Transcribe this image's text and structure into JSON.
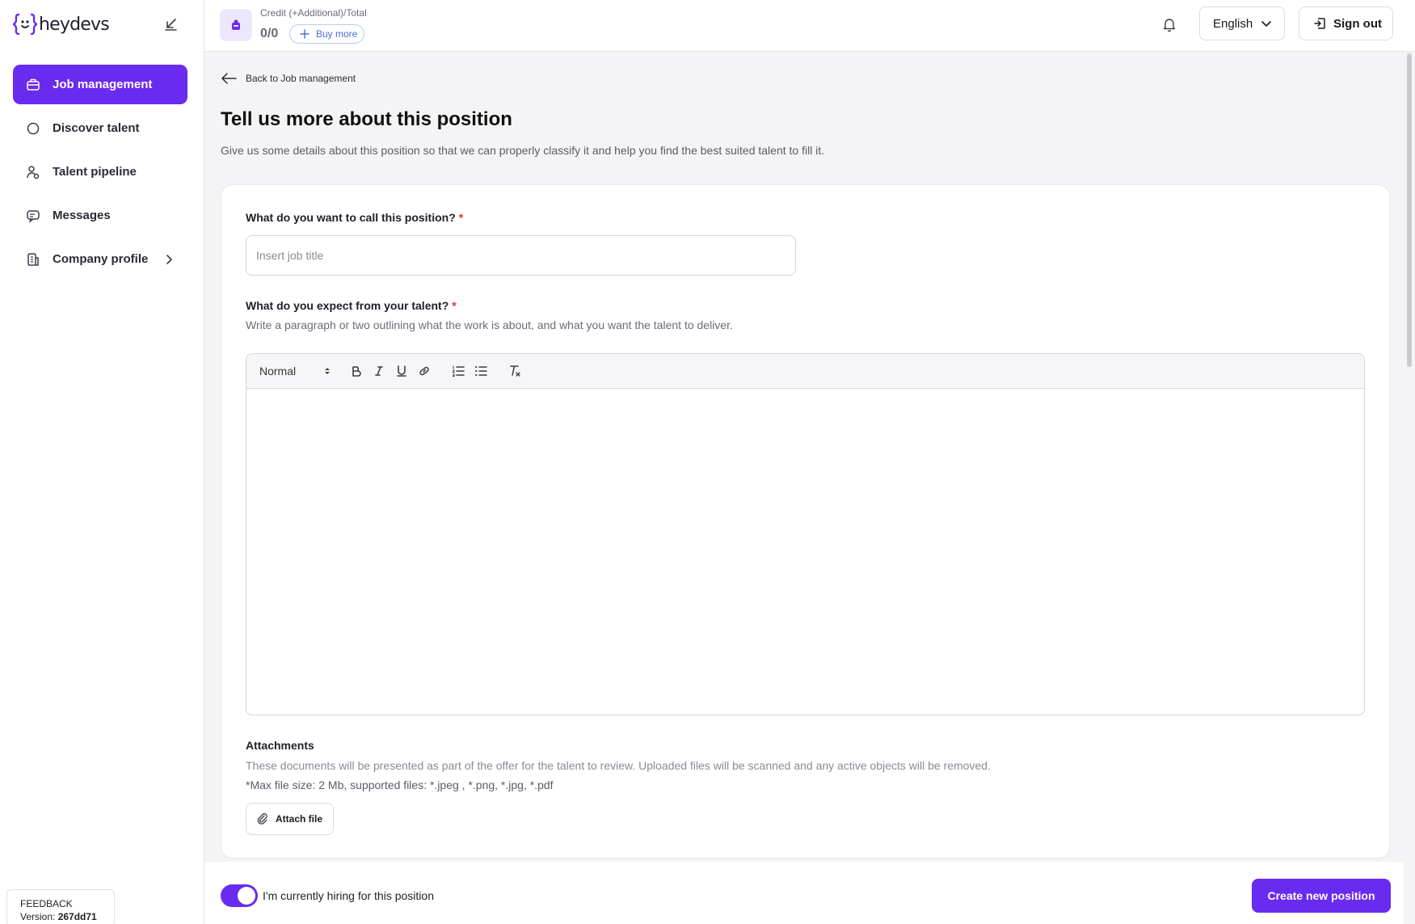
{
  "app": {
    "brand": "heydevs",
    "accent": "#6a2bf0"
  },
  "sidebar": {
    "items": [
      {
        "label": "Job management",
        "icon": "briefcase-icon",
        "active": true
      },
      {
        "label": "Discover talent",
        "icon": "search-icon",
        "active": false
      },
      {
        "label": "Talent pipeline",
        "icon": "users-icon",
        "active": false
      },
      {
        "label": "Messages",
        "icon": "messages-icon",
        "active": false
      },
      {
        "label": "Company profile",
        "icon": "building-icon",
        "active": false,
        "has_submenu": true
      }
    ],
    "feedback": {
      "label": "FEEDBACK",
      "version_label": "Version:",
      "version": "267dd71"
    }
  },
  "topbar": {
    "credit_label": "Credit (+Additional)/Total",
    "credit_value": "0/0",
    "buy_more": "Buy more",
    "language": "English",
    "sign_out": "Sign out"
  },
  "main": {
    "back_link": "Back to Job management",
    "title": "Tell us more about this position",
    "subtitle": "Give us some details about this position so that we can properly classify it and help you find the best suited talent to fill it.",
    "position": {
      "label": "What do you want to call this position?",
      "required_mark": "*",
      "placeholder": "Insert job title",
      "value": ""
    },
    "expectations": {
      "label": "What do you expect from your talent?",
      "required_mark": "*",
      "hint": "Write a paragraph or two outlining what the work is about, and what you want the talent to deliver.",
      "toolbar": {
        "format": "Normal"
      }
    },
    "attachments": {
      "title": "Attachments",
      "description": "These documents will be presented as part of the offer for the talent to review. Uploaded files will be scanned and any active objects will be removed.",
      "note": "*Max file size: 2 Mb, supported files: *.jpeg , *.png, *.jpg, *.pdf",
      "button": "Attach file"
    }
  },
  "footer": {
    "hiring_toggle_on": true,
    "hiring_label": "I'm currently hiring for this position",
    "create_button": "Create new position"
  }
}
